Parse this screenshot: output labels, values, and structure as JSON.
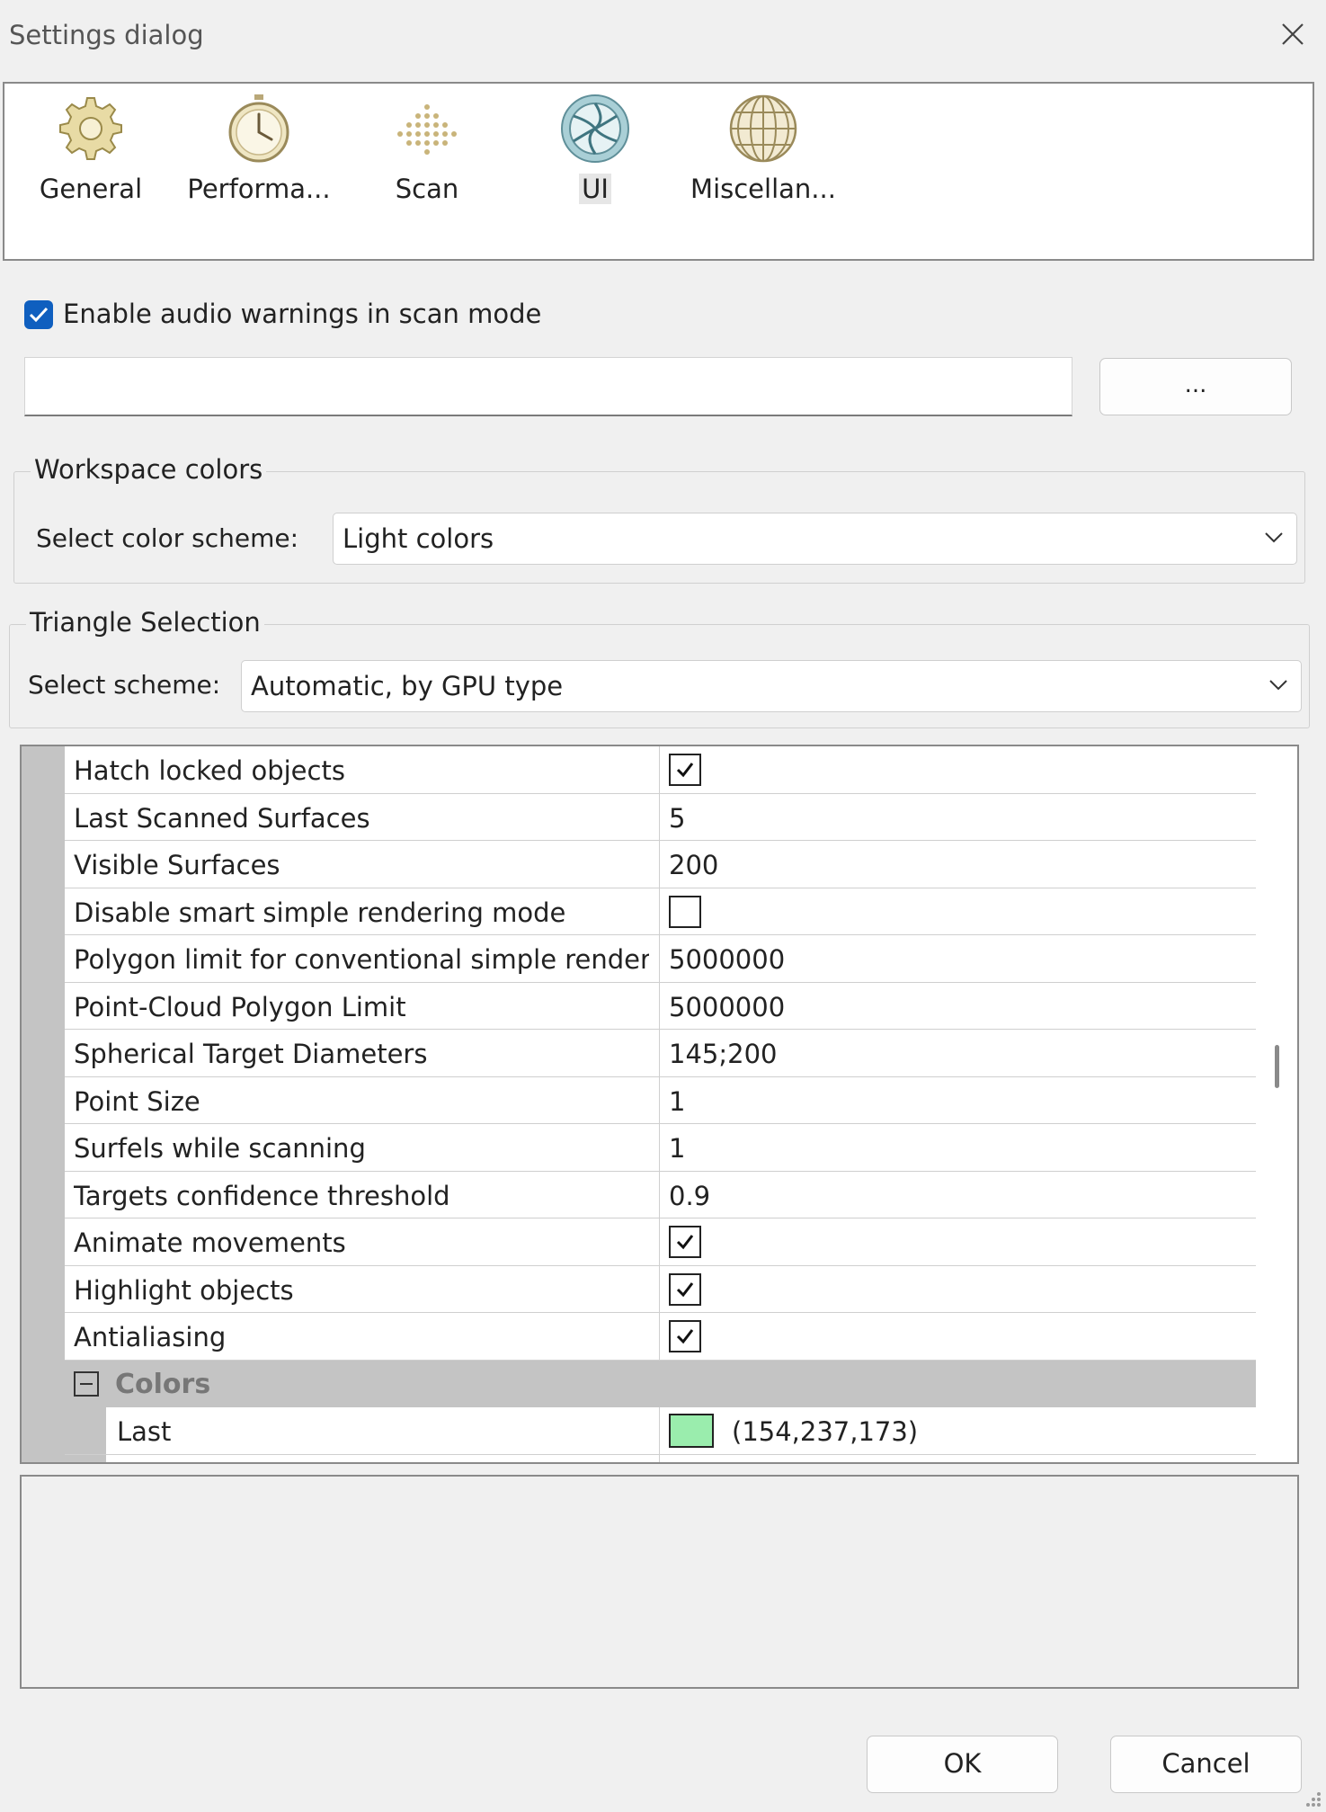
{
  "window": {
    "title": "Settings dialog"
  },
  "categories": [
    {
      "label": "General",
      "icon": "gear-icon"
    },
    {
      "label": "Performa...",
      "icon": "stopwatch-icon"
    },
    {
      "label": "Scan",
      "icon": "dot-grid-icon"
    },
    {
      "label": "UI",
      "icon": "aperture-icon",
      "active": true
    },
    {
      "label": "Miscellan...",
      "icon": "globe-icon"
    }
  ],
  "audio": {
    "label": "Enable audio warnings in scan mode",
    "checked": true,
    "path_value": "",
    "browse_label": "..."
  },
  "workspace": {
    "title": "Workspace colors",
    "label": "Select color scheme:",
    "value": "Light colors"
  },
  "triangle": {
    "title": "Triangle Selection",
    "label": "Select scheme:",
    "value": "Automatic, by GPU type"
  },
  "properties": [
    {
      "name": "Hatch locked objects",
      "checked": true
    },
    {
      "name": "Last Scanned Surfaces",
      "value": "5"
    },
    {
      "name": "Visible Surfaces",
      "value": "200"
    },
    {
      "name": "Disable smart simple rendering mode",
      "checked": false
    },
    {
      "name": "Polygon limit for conventional simple renderi",
      "value": "5000000"
    },
    {
      "name": "Point-Cloud Polygon Limit",
      "value": "5000000"
    },
    {
      "name": "Spherical Target Diameters",
      "value": "145;200"
    },
    {
      "name": "Point Size",
      "value": "1"
    },
    {
      "name": "Surfels while scanning",
      "value": "1"
    },
    {
      "name": "Targets confidence threshold",
      "value": "0.9"
    },
    {
      "name": "Animate movements",
      "checked": true
    },
    {
      "name": "Highlight objects",
      "checked": true
    },
    {
      "name": "Antialiasing",
      "checked": true
    }
  ],
  "colors_category": {
    "label": "Colors"
  },
  "colors_items": [
    {
      "name": "Last",
      "color": "#9aedad",
      "value": "(154,237,173)"
    }
  ],
  "buttons": {
    "ok": "OK",
    "cancel": "Cancel"
  },
  "theme": {
    "accent": "#0f5fbf",
    "gutter": "#c4c4c4"
  }
}
